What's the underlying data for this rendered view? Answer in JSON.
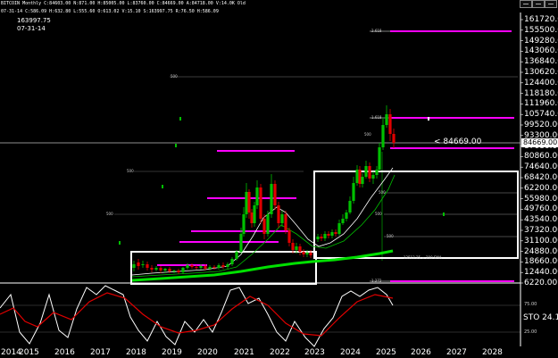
{
  "header": {
    "ticker_line": "BITCOIN Monthly  C:84603.00  N:871.00  H:85005.00  L:83760.00  C:84669.00  A:84718.00  V:14.0K  Old",
    "info_line": "07-31-14  C:586.09  H:632.80  L:555.60  O:613.02  V:15.10  S:163997.75  R:76.50  H:586.09",
    "value": "163997.75",
    "date": "07-31-14"
  },
  "window_controls": [
    "minimize",
    "restore",
    "close"
  ],
  "price_axis": {
    "ticks": [
      "161720.00",
      "155500.00",
      "149280.00",
      "143060.00",
      "136840.00",
      "130620.00",
      "124400.00",
      "118180.00",
      "111960.00",
      "105740.00",
      "99520.00",
      "93300.00",
      "87080.00",
      "80860.00",
      "74640.00",
      "68420.00",
      "62200.00",
      "55980.00",
      "49760.00",
      "43540.00",
      "37320.00",
      "31100.00",
      "24880.00",
      "18660.00",
      "12440.00",
      "6220.00"
    ],
    "current_price": "84669.00",
    "current_price_callout": "< 84669.00"
  },
  "oscillator": {
    "label": "STO 24.1",
    "level_high": "75.00",
    "level_low": "25.00"
  },
  "time_axis": {
    "ticks": [
      "2014",
      "2015",
      "2016",
      "2017",
      "2018",
      "2019",
      "2020",
      "2021",
      "2022",
      "2023",
      "2024",
      "2025",
      "2026",
      "2027",
      "2028"
    ]
  },
  "annotations": {
    "fib_high": "2.618",
    "fib_mid": "1.618",
    "fib_low": "1.272",
    "box1_top": "500",
    "box1_mid": "500",
    "box2_label": "500",
    "box2_mid": "500",
    "misc_left_500": "500",
    "misc_500_a": "500",
    "misc_500_b": "500",
    "ma_label": "13513.25 = 200 SMA"
  },
  "colors": {
    "background": "#000000",
    "magenta": "#ff00ff",
    "green_candle": "#00c000",
    "red_candle": "#e00000",
    "ma_green": "#00ff00",
    "stoch_k": "#ffffff",
    "stoch_d": "#e00000",
    "box": "#ffffff"
  },
  "chart_data": {
    "type": "candlestick",
    "title": "BITCOIN Monthly",
    "ylim": [
      0,
      167000
    ],
    "x": [
      "2014",
      "2015",
      "2016",
      "2017",
      "2018",
      "2019",
      "2020",
      "2021",
      "2022",
      "2023",
      "2024",
      "2025",
      "2026",
      "2027",
      "2028"
    ],
    "series": [
      {
        "name": "BTC",
        "values": [
          586,
          300,
          230,
          430,
          970,
          14000,
          6900,
          3700,
          9000,
          29000,
          47000,
          37000,
          16500,
          23000,
          42000,
          69000,
          61000,
          58000,
          93000,
          102000,
          84669
        ]
      }
    ],
    "stochastic": {
      "levels": [
        75,
        25
      ],
      "last": 24.1
    }
  }
}
